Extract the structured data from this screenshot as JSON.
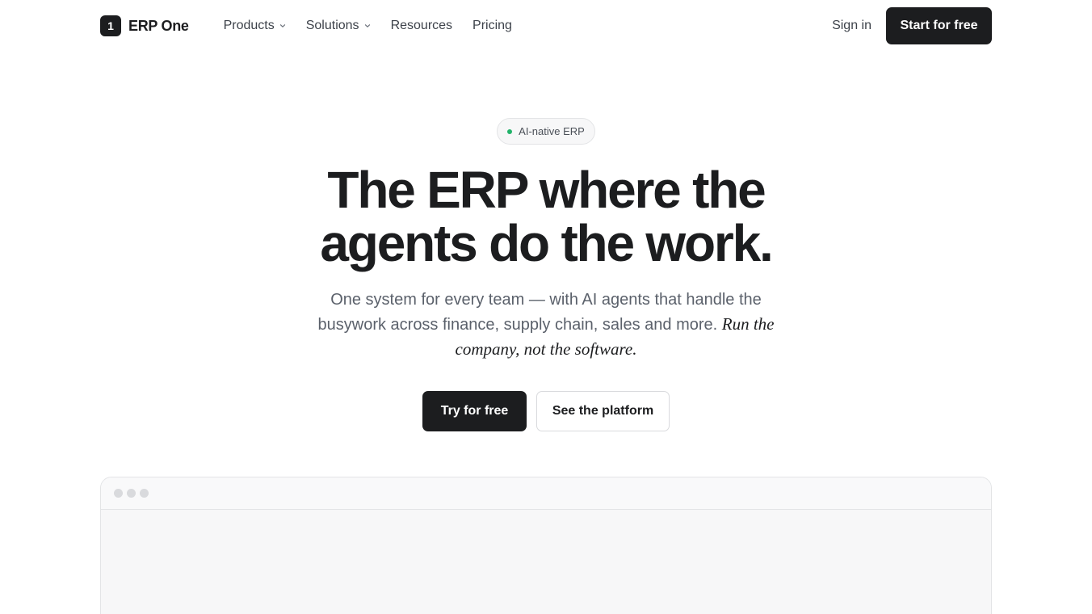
{
  "brand": {
    "mark": "1",
    "name": "ERP One"
  },
  "nav": {
    "items": [
      {
        "label": "Products",
        "dropdown": true
      },
      {
        "label": "Solutions",
        "dropdown": true
      },
      {
        "label": "Resources",
        "dropdown": false
      },
      {
        "label": "Pricing",
        "dropdown": false
      }
    ],
    "sign_in": "Sign in",
    "cta": "Start for free"
  },
  "badge": {
    "label": "AI-native ERP",
    "dot_color": "#22b36a"
  },
  "hero": {
    "title_line1": "The ERP where the",
    "title_line2": "agents do the work.",
    "subtitle": "One system for every team — with AI agents that handle the busywork across finance, supply chain, sales and more.",
    "subtitle_emphasis": "Run the company, not the software.",
    "primary_cta": "Try for free",
    "secondary_cta": "See the platform"
  },
  "preview": {
    "window_controls": [
      "dot",
      "dot",
      "dot"
    ]
  },
  "colors": {
    "ink": "#1c1d1f",
    "muted": "#5b616b",
    "border": "#e3e4e6",
    "accent_green": "#22b36a"
  }
}
